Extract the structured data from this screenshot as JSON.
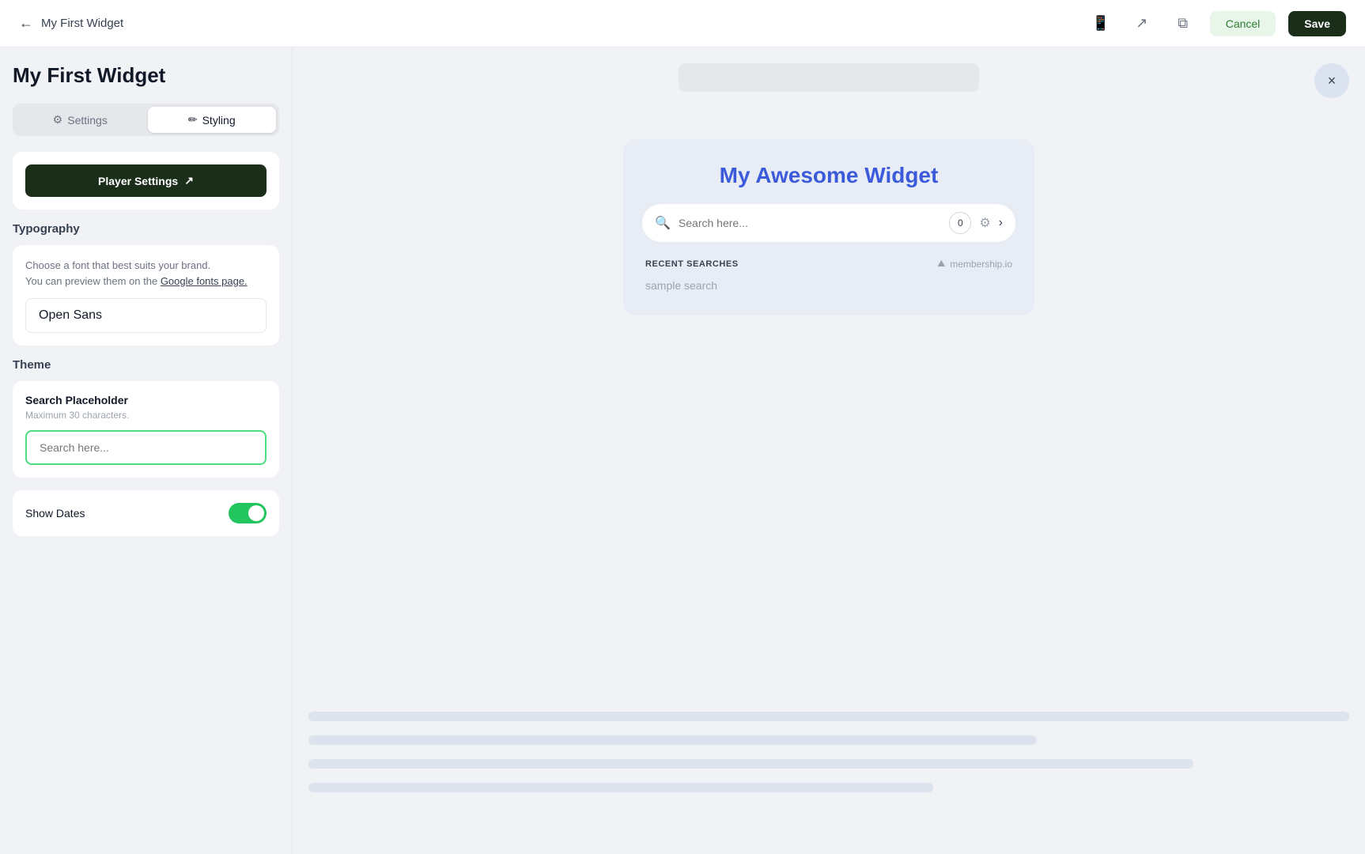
{
  "topbar": {
    "back_label": "←",
    "title": "My First Widget",
    "icons": {
      "mobile": "📱",
      "external": "↗",
      "layers": "⧉"
    },
    "cancel_label": "Cancel",
    "save_label": "Save"
  },
  "sidebar": {
    "title": "My First Widget",
    "tabs": [
      {
        "id": "settings",
        "label": "Settings",
        "icon": "⚙"
      },
      {
        "id": "styling",
        "label": "Styling",
        "icon": "✏"
      }
    ],
    "active_tab": "styling",
    "player_settings_btn": "Player Settings",
    "typography": {
      "section_label": "Typography",
      "description_line1": "Choose a font that best suits your brand.",
      "description_line2": "You can preview them on the",
      "link_text": "Google fonts page.",
      "font_value": "Open Sans"
    },
    "theme": {
      "section_label": "Theme",
      "search_placeholder_label": "Search Placeholder",
      "search_placeholder_hint": "Maximum 30 characters.",
      "search_input_value": "",
      "search_input_placeholder": "Search here..."
    },
    "show_dates": {
      "label": "Show Dates",
      "enabled": true
    }
  },
  "preview": {
    "close_icon": "×",
    "widget_title": "My Awesome Widget",
    "search_placeholder": "Search here...",
    "badge_count": "0",
    "recent_searches": {
      "label": "RECENT SEARCHES",
      "brand_name": "membership.io",
      "items": [
        "sample search"
      ]
    }
  }
}
